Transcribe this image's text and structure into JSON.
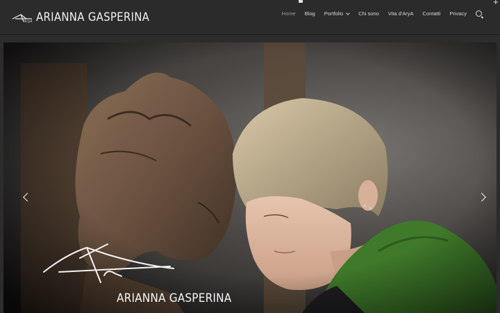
{
  "header": {
    "brand": "ARIANNA GASPERINA",
    "logo_signature": "AryA",
    "plus_label": "+"
  },
  "nav": {
    "items": [
      {
        "label": "Home",
        "active": true
      },
      {
        "label": "Blog"
      },
      {
        "label": "Portfolio",
        "has_dropdown": true
      },
      {
        "label": "Chi sono"
      },
      {
        "label": "Vita d'AryA"
      },
      {
        "label": "Contatti"
      },
      {
        "label": "Privacy"
      }
    ],
    "search_icon": "search-icon"
  },
  "hero": {
    "title": "ARIANNA GASPERINA",
    "signature": "AryA",
    "prev_icon": "chevron-left-icon",
    "next_icon": "chevron-right-icon"
  },
  "colors": {
    "header_bg": "#2b2b2b",
    "page_bg": "#2c2c2c",
    "green_jacket": "#3f7a2a"
  }
}
